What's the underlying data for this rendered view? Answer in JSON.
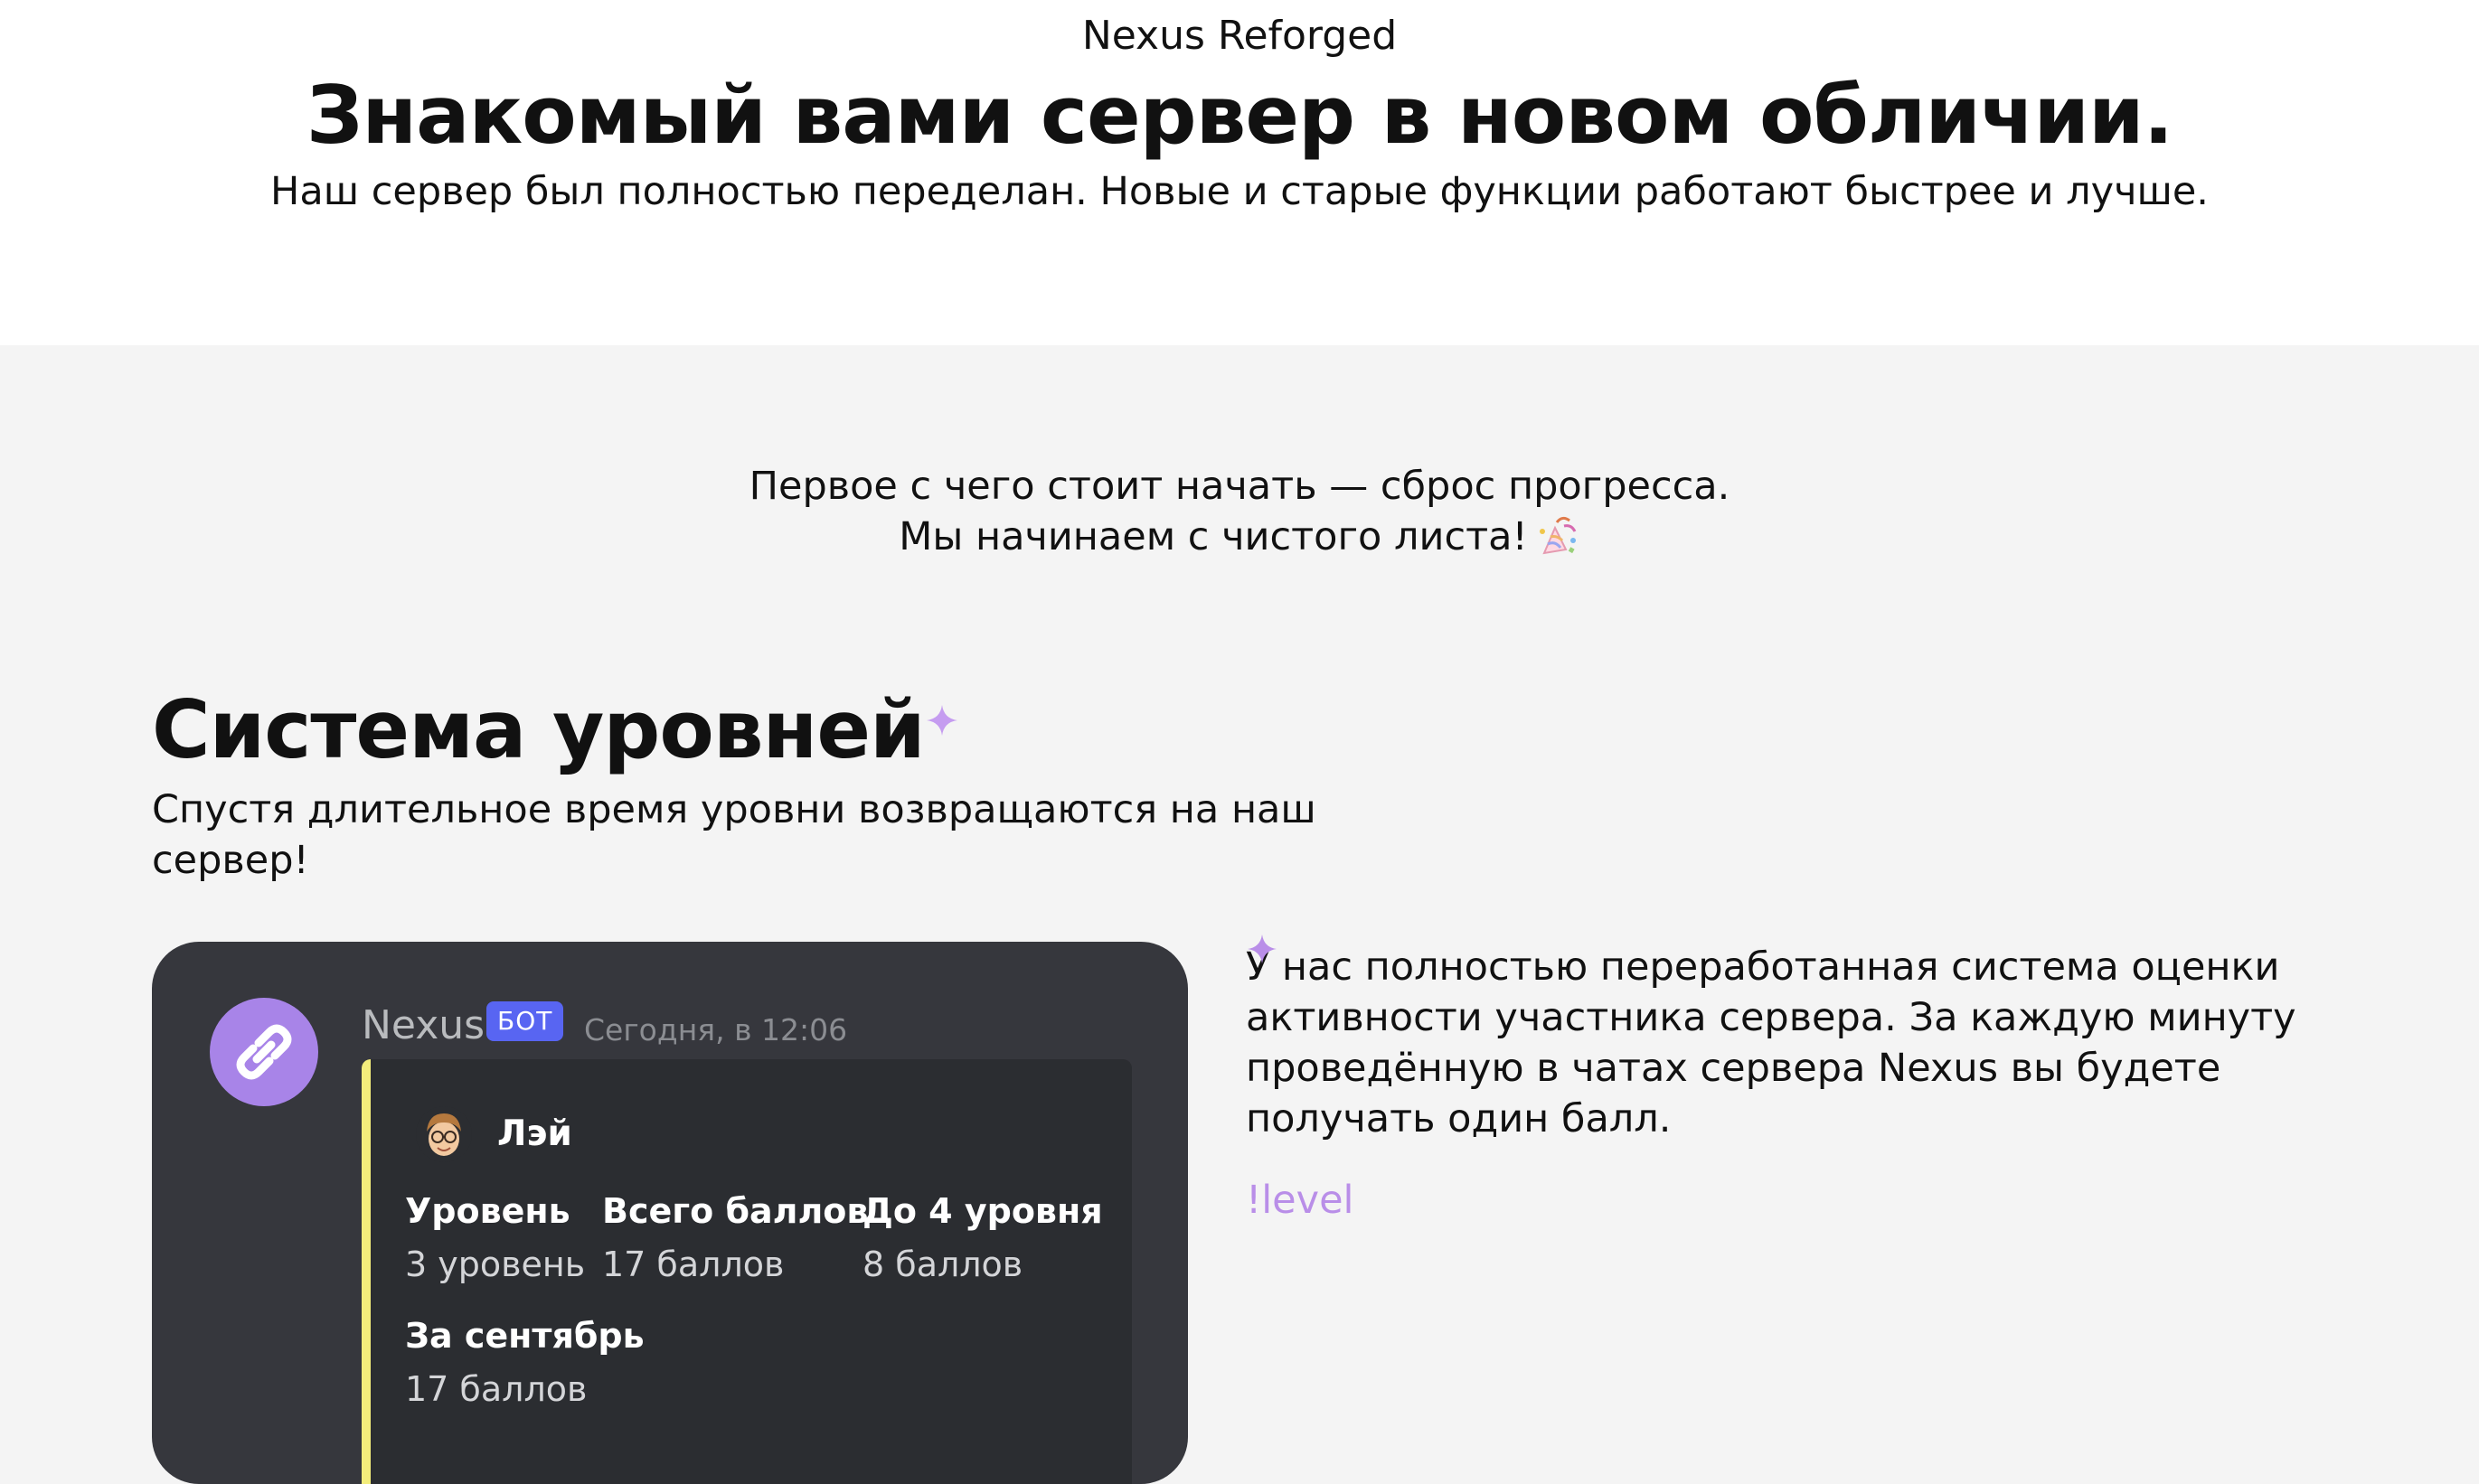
{
  "hero": {
    "brand": "Nexus Reforged",
    "title": "Знакомый вами сервер в новом обличии.",
    "subtitle": "Наш сервер был полностью переделан. Новые и старые функции работают быстрее и лучше."
  },
  "intro": {
    "line1": "Первое с чего стоит начать — сброс прогресса.",
    "line2": "Мы начинаем с чистого листа!",
    "icon": "confetti-icon"
  },
  "levels": {
    "title": "Система уровней",
    "title_icon": "sparkle-icon",
    "description": "Спустя длительное время уровни возвращаются на наш сервер!",
    "text": "У нас полностью переработанная система оценки активности участника сервера. За каждую минуту проведённую в чатах сервера Nexus вы будете получать один балл.",
    "command": "!level",
    "accent_color": "#b98ee8"
  },
  "bot_card": {
    "bot_name": "Nexus",
    "badge": "БОТ",
    "timestamp": "Сегодня, в 12:06",
    "avatar_icon": "link-icon",
    "embed_color": "#f3ed7b",
    "author_name": "Лэй",
    "fields": [
      {
        "label": "Уровень",
        "value": "3 уровень"
      },
      {
        "label": "Всего баллов",
        "value": "17 баллов"
      },
      {
        "label": "До 4 уровня",
        "value": "8 баллов"
      },
      {
        "label": "За сентябрь",
        "value": "17 баллов"
      }
    ]
  }
}
